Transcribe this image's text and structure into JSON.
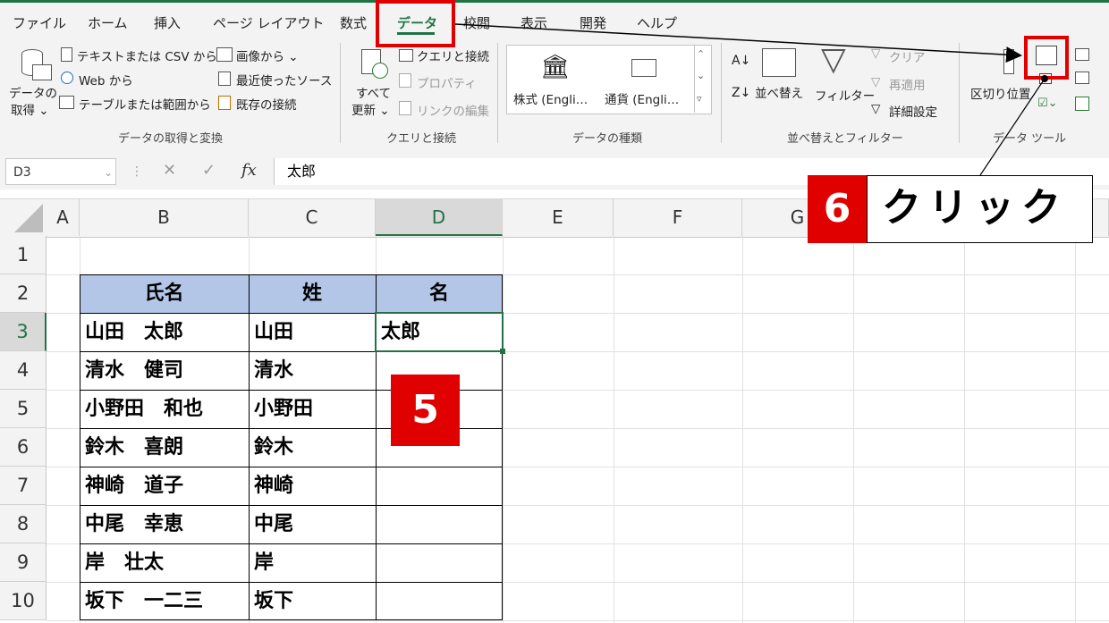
{
  "tabs": [
    "ファイル",
    "ホーム",
    "挿入",
    "ページ レイアウト",
    "数式",
    "データ",
    "校閲",
    "表示",
    "開発",
    "ヘルプ"
  ],
  "active_tab": "データ",
  "ribbon": {
    "get_data": {
      "label_line1": "データの",
      "label_line2": "取得 ⌄"
    },
    "text_csv": "テキストまたは CSV から",
    "web": "Web から",
    "table_range": "テーブルまたは範囲から",
    "from_image": "画像から ⌄",
    "recent_sources": "最近使ったソース",
    "existing_connections": "既存の接続",
    "group_get_transform": "データの取得と変換",
    "refresh_all_line1": "すべて",
    "refresh_all_line2": "更新 ⌄",
    "queries_connections": "クエリと接続",
    "properties": "プロパティ",
    "edit_links": "リンクの編集",
    "group_queries": "クエリと接続",
    "stocks": "株式 (Engli…",
    "currencies": "通貨 (Engli…",
    "group_data_types": "データの種類",
    "sort": "並べ替え",
    "filter": "フィルター",
    "clear": "クリア",
    "reapply": "再適用",
    "advanced": "詳細設定",
    "group_sort_filter": "並べ替えとフィルター",
    "text_to_columns": "区切り位置",
    "group_data_tools": "データ ツール"
  },
  "formula_bar": {
    "name_box": "D3",
    "fx": "fx",
    "value": "太郎"
  },
  "columns": [
    "A",
    "B",
    "C",
    "D",
    "E",
    "F",
    "G"
  ],
  "rows": [
    "1",
    "2",
    "3",
    "4",
    "5",
    "6",
    "7",
    "8",
    "9",
    "10"
  ],
  "table": {
    "headers": [
      "氏名",
      "姓",
      "名"
    ],
    "rows": [
      [
        "山田　太郎",
        "山田",
        "太郎"
      ],
      [
        "清水　健司",
        "清水",
        ""
      ],
      [
        "小野田　和也",
        "小野田",
        ""
      ],
      [
        "鈴木　喜朗",
        "鈴木",
        ""
      ],
      [
        "神崎　道子",
        "神崎",
        ""
      ],
      [
        "中尾　幸恵",
        "中尾",
        ""
      ],
      [
        "岸　壮太",
        "岸",
        ""
      ],
      [
        "坂下　一二三",
        "坂下",
        ""
      ]
    ]
  },
  "annotations": {
    "step5": "5",
    "step6": "6",
    "click_label": "クリック"
  },
  "colors": {
    "accent": "#217346",
    "callout": "#e00000",
    "header_fill": "#b4c6e7"
  }
}
